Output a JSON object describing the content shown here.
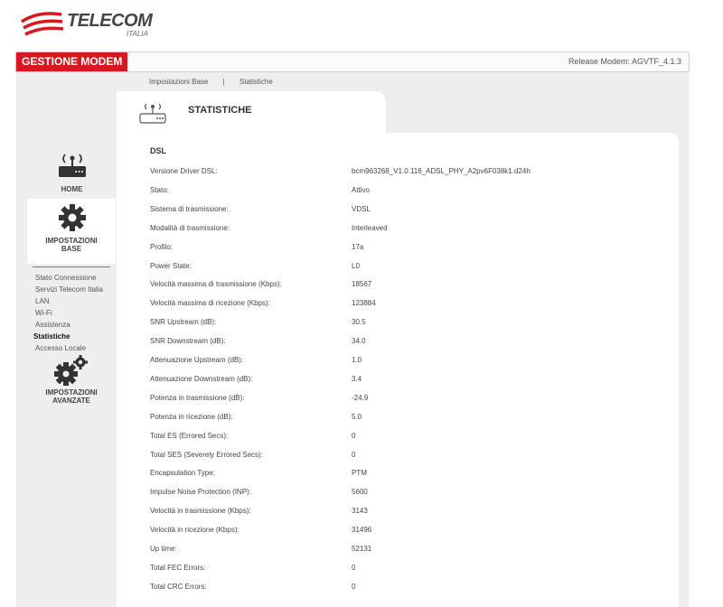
{
  "logo": {
    "name": "TELECOM",
    "sub": "ITALIA"
  },
  "header": {
    "title": "GESTIONE MODEM",
    "release": "Release Modem: AGVTF_4.1.3"
  },
  "nav": {
    "items": [
      "Impostazioni Base",
      "|",
      "Statistiche"
    ]
  },
  "section": {
    "title": "STATISTICHE"
  },
  "sidebar": {
    "home_label": "HOME",
    "base_label_1": "IMPOSTAZIONI",
    "base_label_2": "BASE",
    "submenu": [
      "Stato Connessione",
      "Servizi Telecom Italia",
      "LAN",
      "Wi-Fi",
      "Assistenza",
      "Statistiche",
      "Accesso Locale"
    ],
    "active_index": 5,
    "adv_label_1": "IMPOSTAZIONI",
    "adv_label_2": "AVANZATE"
  },
  "dsl": {
    "heading": "DSL",
    "rows": [
      {
        "label": "Versione Driver DSL:",
        "value": "bcm963268_V1.0.116_ADSL_PHY_A2pv6F038k1.d24h"
      },
      {
        "label": "Stato:",
        "value": "Attivo"
      },
      {
        "label": "Sistema di trasmissione:",
        "value": "VDSL"
      },
      {
        "label": "Modalità di trasmissione:",
        "value": "Interleaved"
      },
      {
        "label": "Profilo:",
        "value": "17a"
      },
      {
        "label": "Power State:",
        "value": "L0"
      },
      {
        "label": "Velocità massima di trasmissione (Kbps):",
        "value": "18567"
      },
      {
        "label": "Velocità massima di ricezione (Kbps):",
        "value": "123884"
      },
      {
        "label": "SNR Upstream (dB):",
        "value": "30.5"
      },
      {
        "label": "SNR Downstream (dB):",
        "value": "34.0"
      },
      {
        "label": "Attenuazione Upstream (dB):",
        "value": "1.0"
      },
      {
        "label": "Attenuazione Downstream (dB):",
        "value": "3.4"
      },
      {
        "label": "Potenza in trasmissione (dB):",
        "value": "-24.9"
      },
      {
        "label": "Potenza in ricezione (dB):",
        "value": "5.0"
      },
      {
        "label": "Total ES (Errored Secs):",
        "value": "0"
      },
      {
        "label": "Total SES (Severely Errored Secs):",
        "value": "0"
      },
      {
        "label": "Encapsulation Type:",
        "value": "PTM"
      },
      {
        "label": "Impulse Noise Protection (INP):",
        "value": "5600"
      },
      {
        "label": "Velocità in trasmissione (Kbps):",
        "value": "3143"
      },
      {
        "label": "Velocità in ricezione (Kbps):",
        "value": "31496"
      },
      {
        "label": "Up time:",
        "value": "52131"
      },
      {
        "label": "Total FEC Errors:",
        "value": "0"
      },
      {
        "label": "Total CRC Errors:",
        "value": "0"
      }
    ]
  },
  "colors": {
    "brand_red": "#d41a1f",
    "frame_gray": "#eeeeee"
  }
}
